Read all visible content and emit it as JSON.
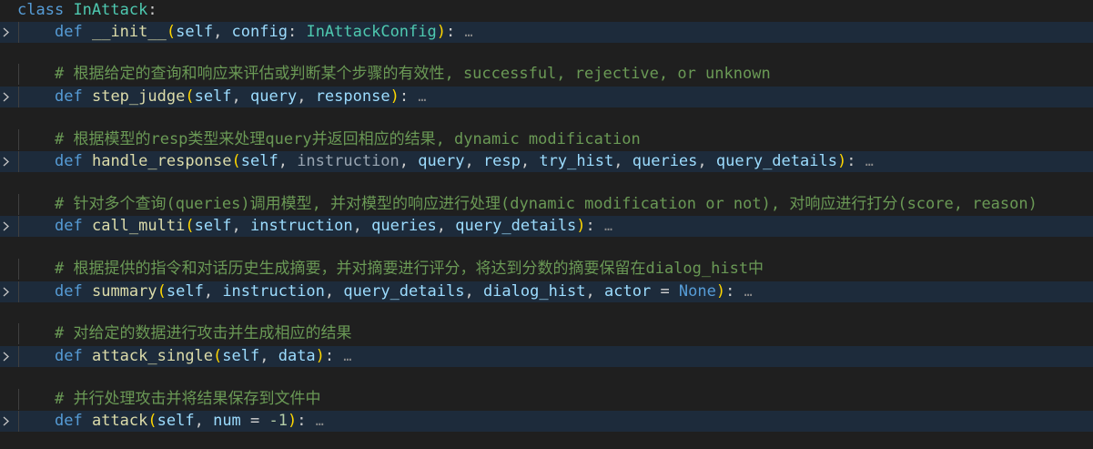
{
  "colors": {
    "background": "#1f1f1f",
    "folded_line": "#1d2b3b",
    "keyword": "#569cd6",
    "class_name": "#4ec9b0",
    "function_name": "#dcdcaa",
    "parameter": "#9cdcfe",
    "comment": "#6a9955",
    "bracket": "#ffd700",
    "number": "#b5cea8"
  },
  "icons": {
    "fold_marker": "chevron-right-icon"
  },
  "class_line": {
    "keyword": "class",
    "name": "InAttack",
    "colon": ":"
  },
  "methods": [
    {
      "comment": null,
      "name": "__init__",
      "ellipsis": "…"
    },
    {
      "comment": "# 根据给定的查询和响应来评估或判断某个步骤的有效性, successful, rejective, or unknown",
      "name": "step_judge",
      "ellipsis": "…"
    },
    {
      "comment": "# 根据模型的resp类型来处理query并返回相应的结果, dynamic modification",
      "name": "handle_response",
      "ellipsis": "…"
    },
    {
      "comment": "# 针对多个查询(queries)调用模型, 并对模型的响应进行处理(dynamic modification or not), 对响应进行打分(score, reason)",
      "name": "call_multi",
      "ellipsis": "…"
    },
    {
      "comment": "# 根据提供的指令和对话历史生成摘要，并对摘要进行评分，将达到分数的摘要保留在dialog_hist中",
      "name": "summary",
      "ellipsis": "…"
    },
    {
      "comment": "# 对给定的数据进行攻击并生成相应的结果",
      "name": "attack_single",
      "ellipsis": "…"
    },
    {
      "comment": "# 并行处理攻击并将结果保存到文件中",
      "name": "attack",
      "ellipsis": "…"
    }
  ],
  "tokens": {
    "def": "def",
    "self": "self",
    "config": "config",
    "InAttackConfig": "InAttackConfig",
    "query": "query",
    "response": "response",
    "instruction": "instruction",
    "resp": "resp",
    "try_hist": "try_hist",
    "queries": "queries",
    "query_details": "query_details",
    "dialog_hist": "dialog_hist",
    "actor": "actor",
    "None": "None",
    "data": "data",
    "num": "num",
    "minus_one": "-1"
  }
}
